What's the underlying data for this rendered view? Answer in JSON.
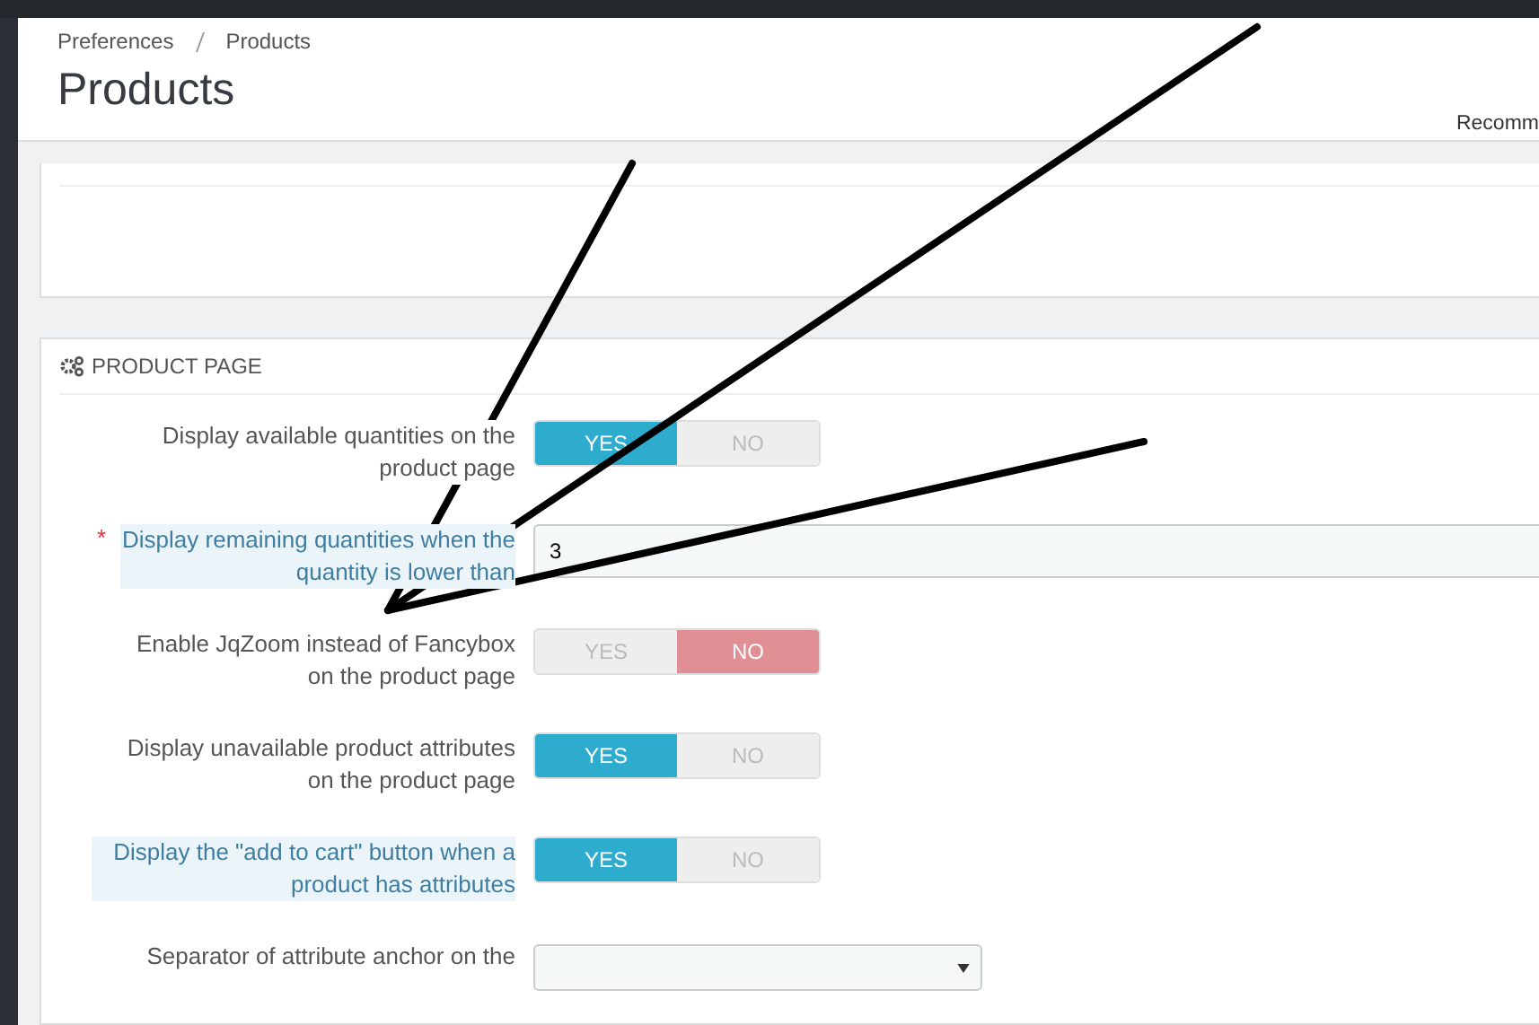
{
  "breadcrumb": [
    "Preferences",
    "Products"
  ],
  "page_title": "Products",
  "header_link": "Recomm",
  "panel": {
    "title": "PRODUCT PAGE",
    "fields": [
      {
        "kind": "toggle",
        "label": "Display available quantities on the product page",
        "help": false,
        "options": [
          {
            "label": "YES",
            "selected": true
          },
          {
            "label": "NO",
            "selected": false
          }
        ]
      },
      {
        "kind": "input",
        "label": "Display remaining quantities when the quantity is lower than",
        "help": true,
        "required_mark": "*",
        "value": "3"
      },
      {
        "kind": "toggle",
        "label": "Enable JqZoom instead of Fancybox on the product page",
        "help": false,
        "options": [
          {
            "label": "YES",
            "selected": false
          },
          {
            "label": "NO",
            "selected": true
          }
        ]
      },
      {
        "kind": "toggle",
        "label": "Display unavailable product attributes on the product page",
        "help": false,
        "options": [
          {
            "label": "YES",
            "selected": true
          },
          {
            "label": "NO",
            "selected": false
          }
        ]
      },
      {
        "kind": "toggle",
        "label": "Display the \"add to cart\" button when a product has attributes",
        "help": true,
        "options": [
          {
            "label": "YES",
            "selected": true
          },
          {
            "label": "NO",
            "selected": false
          }
        ]
      },
      {
        "kind": "select",
        "label": "Separator of attribute anchor on the",
        "help": false
      }
    ]
  }
}
